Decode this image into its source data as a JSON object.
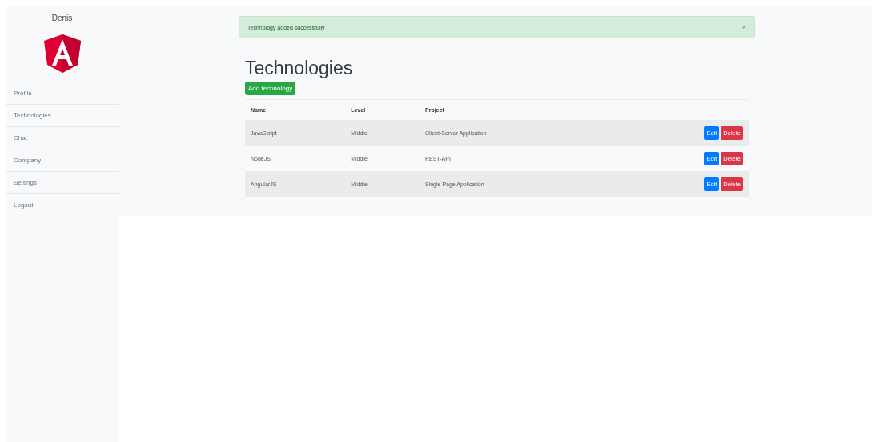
{
  "sidebar": {
    "user": "Denis",
    "items": [
      {
        "label": "Profile"
      },
      {
        "label": "Technologies"
      },
      {
        "label": "Chat"
      },
      {
        "label": "Company"
      },
      {
        "label": "Settings"
      },
      {
        "label": "Logout"
      }
    ]
  },
  "alert": {
    "message": "Technology added successfully",
    "close": "×"
  },
  "title": "Technologies",
  "add_button": "Add technology",
  "table": {
    "columns": [
      "Name",
      "Level",
      "Project"
    ],
    "rows": [
      {
        "name": "JavaScript",
        "level": "Middle",
        "project": "Client-Server Application",
        "edit": "Edit",
        "delete": "Delete"
      },
      {
        "name": "NodeJS",
        "level": "Middle",
        "project": "REST-API",
        "edit": "Edit",
        "delete": "Delete"
      },
      {
        "name": "AngularJS",
        "level": "Middle",
        "project": "Single Page Application",
        "edit": "Edit",
        "delete": "Delete"
      }
    ]
  }
}
